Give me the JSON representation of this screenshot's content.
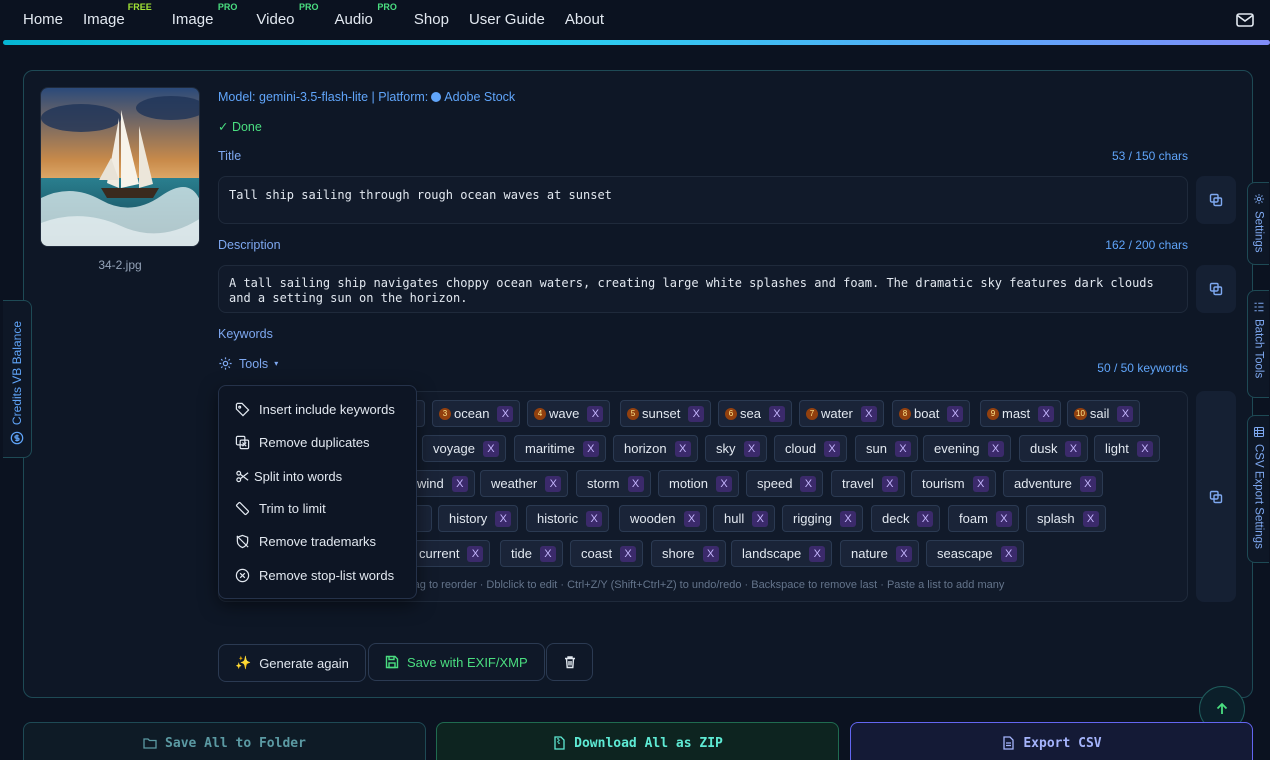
{
  "nav": {
    "items": [
      {
        "label": "Home",
        "badge": ""
      },
      {
        "label": "Image",
        "badge": "FREE"
      },
      {
        "label": "Image",
        "badge": "PRO"
      },
      {
        "label": "Video",
        "badge": "PRO"
      },
      {
        "label": "Audio",
        "badge": "PRO"
      },
      {
        "label": "Shop",
        "badge": ""
      },
      {
        "label": "User Guide",
        "badge": ""
      },
      {
        "label": "About",
        "badge": ""
      }
    ],
    "mail_icon": "mail-icon"
  },
  "file": {
    "name": "34-2.jpg",
    "model_label": "Model: gemini-3.5-flash-lite | Platform:",
    "platform": "Adobe Stock",
    "status": "✓ Done"
  },
  "title": {
    "label": "Title",
    "count": "53 / 150 chars",
    "value": "Tall ship sailing through rough ocean waves at sunset"
  },
  "description": {
    "label": "Description",
    "count": "162 / 200 chars",
    "value": "A tall sailing ship navigates choppy ocean waters, creating large white splashes and foam. The dramatic sky features dark clouds and a setting sun on the horizon."
  },
  "keywords": {
    "label": "Keywords",
    "tools_label": "Tools",
    "count": "50 / 50 keywords",
    "hint": "rag to reorder · Dblclick to edit · Ctrl+Z/Y (Shift+Ctrl+Z) to undo/redo · Backspace to remove last · Paste a list to add many",
    "remove_label": "X",
    "row1": [
      {
        "num": "3",
        "text": "ocean"
      },
      {
        "num": "4",
        "text": "wave"
      },
      {
        "num": "5",
        "text": "sunset"
      },
      {
        "num": "6",
        "text": "sea"
      },
      {
        "num": "7",
        "text": "water"
      },
      {
        "num": "8",
        "text": "boat"
      },
      {
        "num": "9",
        "text": "mast"
      },
      {
        "num": "10",
        "text": "sail"
      }
    ],
    "row2": [
      "voyage",
      "maritime",
      "horizon",
      "sky",
      "cloud",
      "sun",
      "evening",
      "dusk",
      "light"
    ],
    "row3": [
      "wind",
      "weather",
      "storm",
      "motion",
      "speed",
      "travel",
      "tourism",
      "adventure"
    ],
    "row4": [
      "history",
      "historic",
      "wooden",
      "hull",
      "rigging",
      "deck",
      "foam",
      "splash"
    ],
    "row5": [
      "current",
      "tide",
      "coast",
      "shore",
      "landscape",
      "nature",
      "seascape"
    ]
  },
  "tools_menu": [
    {
      "label": "Insert include keywords",
      "icon": "tag-icon"
    },
    {
      "label": "Remove duplicates",
      "icon": "copy-x-icon"
    },
    {
      "label": "Split into words",
      "icon": "scissors-icon"
    },
    {
      "label": "Trim to limit",
      "icon": "ruler-icon"
    },
    {
      "label": "Remove trademarks",
      "icon": "shield-off-icon"
    },
    {
      "label": "Remove stop-list words",
      "icon": "circle-x-icon"
    }
  ],
  "actions": {
    "generate": "Generate again",
    "save_exif": "Save with EXIF/XMP"
  },
  "bottom": {
    "save_folder": "Save All to Folder",
    "download_zip": "Download All as ZIP",
    "export_csv": "Export CSV"
  },
  "side_tabs": {
    "settings": "Settings",
    "batch": "Batch Tools",
    "csv": "CSV Export Settings",
    "credits": "Credits VB Balance"
  }
}
